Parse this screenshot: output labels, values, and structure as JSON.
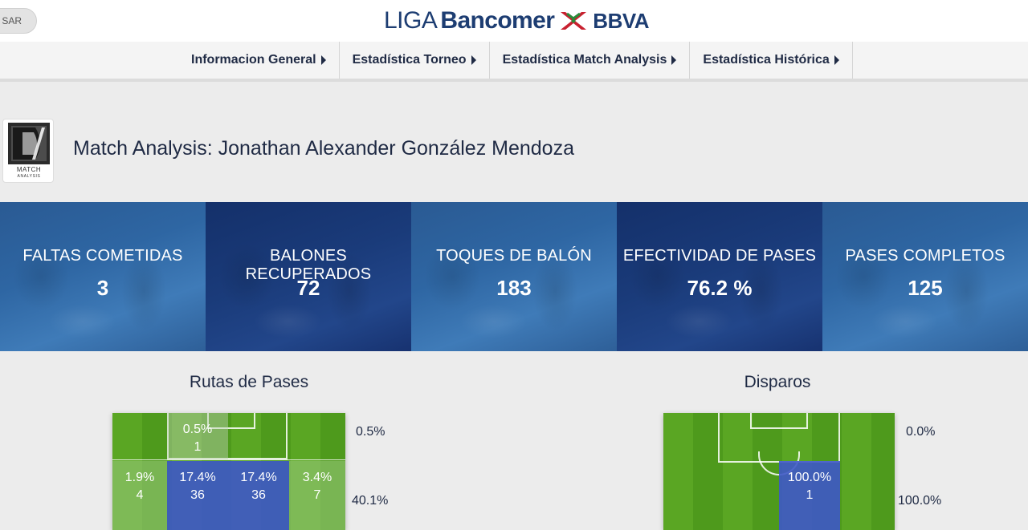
{
  "header": {
    "login_fragment": "SAR",
    "brand": {
      "liga": "LIGA",
      "bancomer": "Bancomer",
      "bbva": "BBVA"
    }
  },
  "nav": {
    "items": [
      {
        "label": "Informacion General"
      },
      {
        "label": "Estadística Torneo"
      },
      {
        "label": "Estadística Match Analysis"
      },
      {
        "label": "Estadística Histórica"
      }
    ]
  },
  "page": {
    "title": "Match Analysis: Jonathan Alexander González Mendoza",
    "logo_text": "MATCH",
    "logo_subtext": "ANALYSIS"
  },
  "stats": [
    {
      "label": "FALTAS COMETIDAS",
      "value": "3"
    },
    {
      "label": "BALONES RECUPERADOS",
      "value": "72"
    },
    {
      "label": "TOQUES DE BALÓN",
      "value": "183"
    },
    {
      "label": "EFECTIVIDAD DE PASES",
      "value": "76.2 %"
    },
    {
      "label": "PASES COMPLETOS",
      "value": "125"
    }
  ],
  "passes": {
    "title": "Rutas de Pases",
    "row_pct": [
      "0.5%",
      "40.1%"
    ],
    "zones_row1": [
      {
        "pct": "0.5%",
        "count": "1"
      }
    ],
    "zones_row2": [
      {
        "pct": "1.9%",
        "count": "4"
      },
      {
        "pct": "17.4%",
        "count": "36"
      },
      {
        "pct": "17.4%",
        "count": "36"
      },
      {
        "pct": "3.4%",
        "count": "7"
      }
    ]
  },
  "shots": {
    "title": "Disparos",
    "row_pct": [
      "0.0%",
      "100.0%"
    ],
    "zone": {
      "pct": "100.0%",
      "count": "1"
    }
  },
  "colors": {
    "navy": "#1f2a44",
    "stat_light": "#2e66a3",
    "stat_dark": "#1a3b7a",
    "pitch_green": "#5aa623",
    "zone_blue": "#3e58c8"
  }
}
